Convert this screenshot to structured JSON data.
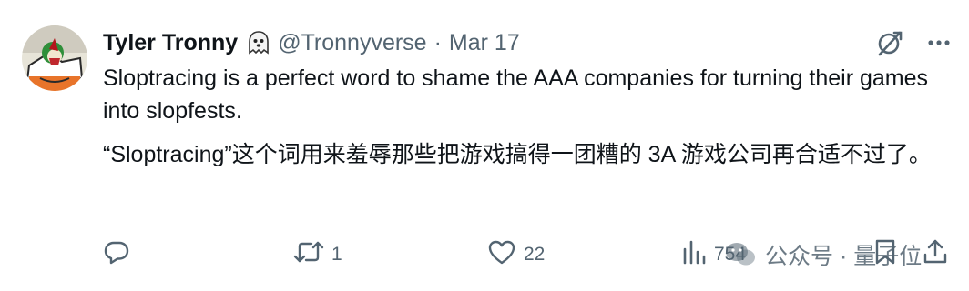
{
  "tweet": {
    "author": {
      "display_name": "Tyler Tronny",
      "handle": "@Tronnyverse",
      "badge_icon": "ghost-icon",
      "avatar_icon": "avatar-illustration"
    },
    "separator": "·",
    "date": "Mar 17",
    "text": {
      "original": "Sloptracing is a perfect word to shame the AAA companies for turning their games into slopfests.",
      "translation": "“Sloptracing”这个词用来羞辱那些把游戏搞得一团糟的 3A 游戏公司再合适不过了。"
    },
    "actions": {
      "reply": {
        "icon": "reply-icon",
        "count": ""
      },
      "retweet": {
        "icon": "retweet-icon",
        "count": "1"
      },
      "like": {
        "icon": "heart-icon",
        "count": "22"
      },
      "views": {
        "icon": "views-icon",
        "count": "754"
      },
      "bookmark": {
        "icon": "bookmark-icon"
      },
      "share": {
        "icon": "share-icon"
      }
    },
    "top_actions": [
      "grok-icon",
      "more-icon"
    ]
  },
  "watermark": {
    "text": "公众号 · 量子位",
    "icon": "wechat-icon"
  },
  "colors": {
    "text_primary": "#0f1419",
    "text_secondary": "#536471",
    "background": "#ffffff"
  }
}
